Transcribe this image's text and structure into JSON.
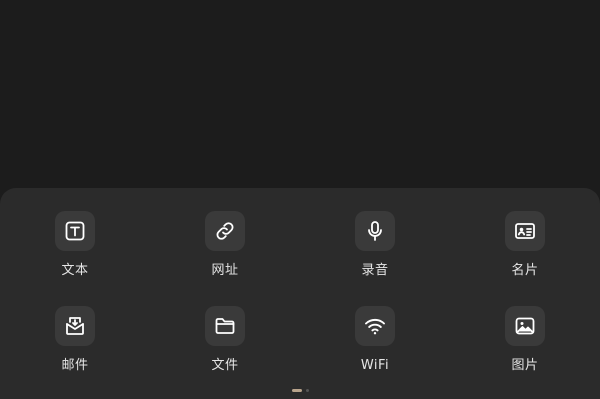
{
  "items": [
    {
      "label": "文本",
      "icon": "text-icon"
    },
    {
      "label": "网址",
      "icon": "link-icon"
    },
    {
      "label": "录音",
      "icon": "microphone-icon"
    },
    {
      "label": "名片",
      "icon": "contact-card-icon"
    },
    {
      "label": "邮件",
      "icon": "mail-icon"
    },
    {
      "label": "文件",
      "icon": "folder-icon"
    },
    {
      "label": "WiFi",
      "icon": "wifi-icon"
    },
    {
      "label": "图片",
      "icon": "image-icon"
    }
  ],
  "pager": {
    "pages": 2,
    "current": 1
  },
  "colors": {
    "background": "#1c1c1c",
    "sheet": "#2b2b2b",
    "tile": "#3a3a3a",
    "icon": "#ffffff",
    "label": "#e6e6e6",
    "page_indicator_active": "#b9a48c"
  }
}
